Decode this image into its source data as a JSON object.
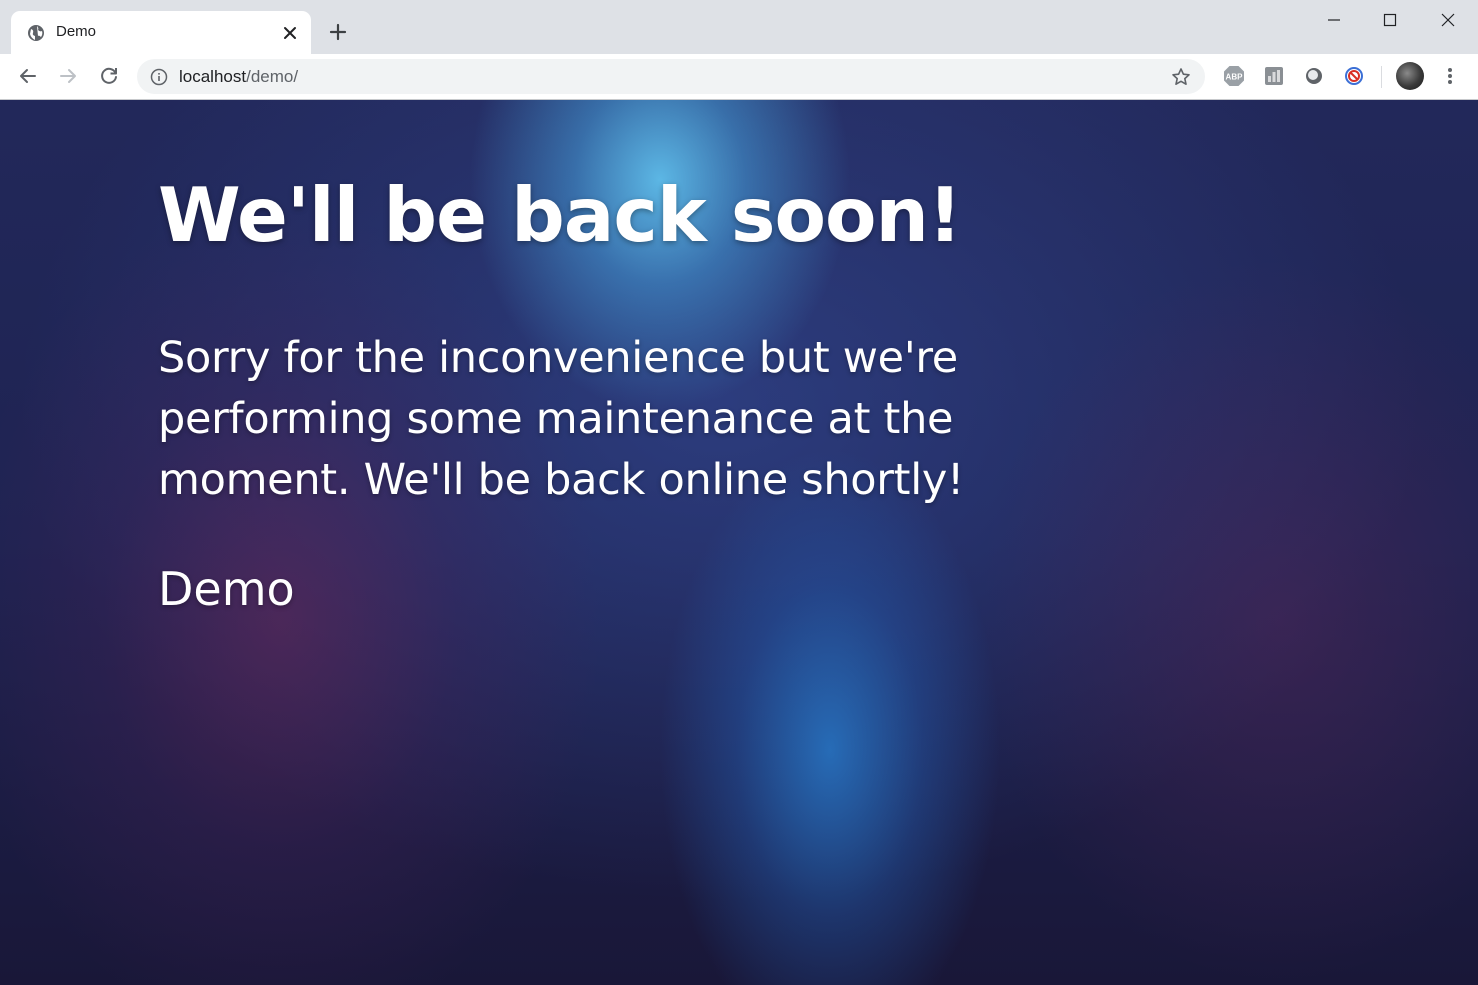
{
  "browser": {
    "tab": {
      "title": "Demo",
      "favicon": "globe-icon",
      "close_icon": "close-icon"
    },
    "new_tab_icon": "plus-icon",
    "window_controls": [
      "minimize-icon",
      "maximize-icon",
      "close-icon"
    ],
    "toolbar": {
      "nav_icons": [
        "back-arrow-icon",
        "forward-arrow-icon",
        "reload-icon"
      ],
      "url_host": "localhost",
      "url_path": "/demo/",
      "site_info_icon": "info-icon",
      "bookmark_icon": "star-icon",
      "extensions": [
        "adblock-plus-icon",
        "extension-chart-icon",
        "extension-circle-icon",
        "extension-block-icon"
      ],
      "profile": "avatar",
      "menu_icon": "kebab-menu-icon"
    }
  },
  "page": {
    "heading": "We'll be back soon!",
    "message": "Sorry for the inconvenience but we're performing some maintenance at the moment. We'll be back online shortly!",
    "signature": "Demo"
  },
  "colors": {
    "tabstrip": "#dee1e6",
    "omnibox": "#f1f3f4",
    "page_background": "#1e2352",
    "glow_blue": "#5fbeeb",
    "text": "#ffffff"
  }
}
